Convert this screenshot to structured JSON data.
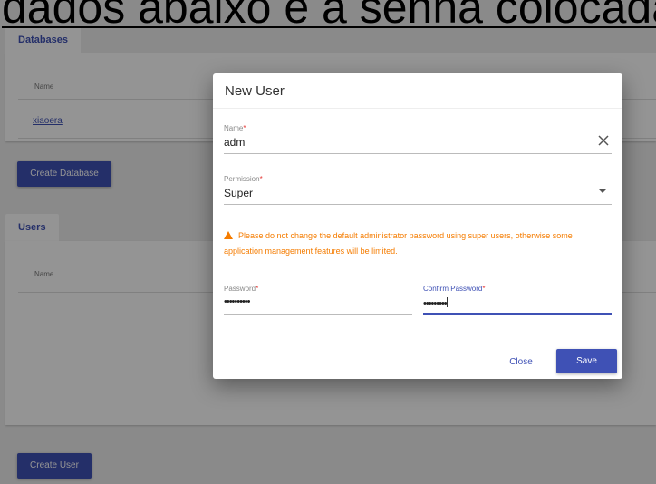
{
  "caption": "dados abaixo  e a senha colocada",
  "databases": {
    "tab_label": "Databases",
    "column_name": "Name",
    "rows": [
      "xiaoera"
    ],
    "create_button": "Create Database"
  },
  "users": {
    "tab_label": "Users",
    "column_name": "Name",
    "create_button": "Create User"
  },
  "dialog": {
    "title": "New User",
    "name": {
      "label": "Name",
      "required": "*",
      "value": "adm"
    },
    "permission": {
      "label": "Permission",
      "required": "*",
      "value": "Super"
    },
    "warning": "Please do not change the default administrator password using super users, otherwise some application management features will be limited.",
    "password": {
      "label": "Password",
      "required": "*",
      "value": "••••••••••"
    },
    "confirm_password": {
      "label": "Confirm Password",
      "required": "*",
      "value": "•••••••••"
    },
    "close_button": "Close",
    "save_button": "Save"
  },
  "colors": {
    "primary": "#3f51b5",
    "warning": "#f57c00",
    "required": "#e53935"
  }
}
